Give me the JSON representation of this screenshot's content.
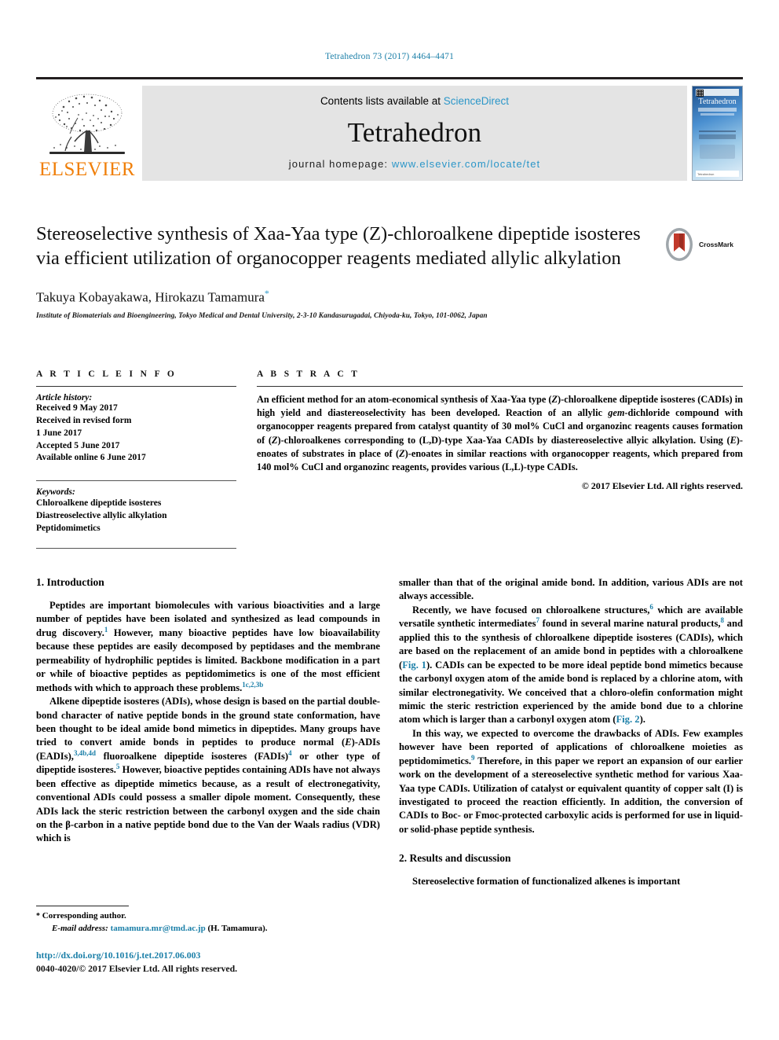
{
  "running_head": "Tetrahedron 73 (2017) 4464–4471",
  "masthead": {
    "publisher_word": "ELSEVIER",
    "contents_prefix": "Contents lists available at ",
    "contents_link": "ScienceDirect",
    "journal_title": "Tetrahedron",
    "homepage_prefix": "journal homepage: ",
    "homepage_url": "www.elsevier.com/locate/tet",
    "cover_title": "Tetrahedron",
    "cover_footer": "Tetrahedron"
  },
  "title_block": {
    "title": "Stereoselective synthesis of Xaa-Yaa type (Z)-chloroalkene dipeptide isosteres via efficient utilization of organocopper reagents mediated allylic alkylation",
    "authors": "Takuya Kobayakawa, Hirokazu Tamamura",
    "corresponding_marker": "*",
    "affiliation": "Institute of Biomaterials and Bioengineering, Tokyo Medical and Dental University, 2-3-10 Kandasurugadai, Chiyoda-ku, Tokyo, 101-0062, Japan",
    "crossmark_label": "CrossMark"
  },
  "article_info": {
    "heading": "A R T I C L E  I N F O",
    "history_label": "Article history:",
    "history_lines": [
      "Received 9 May 2017",
      "Received in revised form",
      "1 June 2017",
      "Accepted 5 June 2017",
      "Available online 6 June 2017"
    ],
    "keywords_label": "Keywords:",
    "keywords": [
      "Chloroalkene dipeptide isosteres",
      "Diastreoselective allylic alkylation",
      "Peptidomimetics"
    ]
  },
  "abstract": {
    "heading": "A B S T R A C T",
    "text_segments": [
      {
        "t": "An efficient method for an atom-economical synthesis of Xaa-Yaa type ("
      },
      {
        "t": "Z",
        "style": "italic"
      },
      {
        "t": ")-chloroalkene dipeptide isosteres (CADIs) in high yield and diastereoselectivity has been developed. Reaction of an allylic "
      },
      {
        "t": "gem",
        "style": "italic"
      },
      {
        "t": "-dichloride compound with organocopper reagents prepared from catalyst quantity of 30 mol% CuCl and organozinc reagents causes formation of ("
      },
      {
        "t": "Z",
        "style": "italic"
      },
      {
        "t": ")-chloroalkenes corresponding to (L,D)-type Xaa-Yaa CADIs by diastereoselective allyic alkylation. Using ("
      },
      {
        "t": "E",
        "style": "italic"
      },
      {
        "t": ")-enoates of substrates in place of ("
      },
      {
        "t": "Z",
        "style": "italic"
      },
      {
        "t": ")-enoates in similar reactions with organocopper reagents, which prepared from 140 mol% CuCl and organozinc reagents, provides various (L,L)-type CADIs."
      }
    ],
    "copyright": "© 2017 Elsevier Ltd. All rights reserved."
  },
  "sections": {
    "intro_heading": "1. Introduction",
    "results_heading": "2. Results and discussion"
  },
  "columns": {
    "left": [
      {
        "id": "p1",
        "segments": [
          {
            "t": "Peptides are important biomolecules with various bioactivities and a large number of peptides have been isolated and synthesized as lead compounds in drug discovery."
          },
          {
            "t": "1",
            "style": "ref"
          },
          {
            "t": " However, many bioactive peptides have low bioavailability because these peptides are easily decomposed by peptidases and the membrane permeability of hydrophilic peptides is limited. Backbone modification in a part or while of bioactive peptides as peptidomimetics is one of the most efficient methods with which to approach these problems."
          },
          {
            "t": "1c,2,3b",
            "style": "ref"
          }
        ]
      },
      {
        "id": "p2",
        "segments": [
          {
            "t": "Alkene dipeptide isosteres (ADIs), whose design is based on the partial double-bond character of native peptide bonds in the ground state conformation, have been thought to be ideal amide bond mimetics in dipeptides. Many groups have tried to convert amide bonds in peptides to produce normal ("
          },
          {
            "t": "E",
            "style": "italic"
          },
          {
            "t": ")-ADIs (EADIs),"
          },
          {
            "t": "3,4b,4d",
            "style": "ref"
          },
          {
            "t": " fluoroalkene dipeptide isosteres (FADIs)"
          },
          {
            "t": "4",
            "style": "ref"
          },
          {
            "t": " or other type of dipeptide isosteres."
          },
          {
            "t": "5",
            "style": "ref"
          },
          {
            "t": " However, bioactive peptides containing ADIs have not always been effective as dipeptide mimetics because, as a result of electronegativity, conventional ADIs could possess a smaller dipole moment. Consequently, these ADIs lack the steric restriction between the carbonyl oxygen and the side chain on the β-carbon in a native peptide bond due to the Van der Waals radius (VDR) which is"
          }
        ]
      }
    ],
    "right": [
      {
        "id": "p3",
        "indent": false,
        "segments": [
          {
            "t": "smaller than that of the original amide bond. In addition, various ADIs are not always accessible."
          }
        ]
      },
      {
        "id": "p4",
        "indent": true,
        "segments": [
          {
            "t": "Recently, we have focused on chloroalkene structures,"
          },
          {
            "t": "6",
            "style": "ref"
          },
          {
            "t": " which are available versatile synthetic intermediates"
          },
          {
            "t": "7",
            "style": "ref"
          },
          {
            "t": " found in several marine natural products,"
          },
          {
            "t": "8",
            "style": "ref"
          },
          {
            "t": " and applied this to the synthesis of chloroalkene dipeptide isosteres (CADIs), which are based on the replacement of an amide bond in peptides with a chloroalkene ("
          },
          {
            "t": "Fig. 1",
            "style": "link"
          },
          {
            "t": "). CADIs can be expected to be more ideal peptide bond mimetics because the carbonyl oxygen atom of the amide bond is replaced by a chlorine atom, with similar electronegativity. We conceived that a chloro-olefin conformation might mimic the steric restriction experienced by the amide bond due to a chlorine atom which is larger than a carbonyl oxygen atom ("
          },
          {
            "t": "Fig. 2",
            "style": "link"
          },
          {
            "t": ")."
          }
        ]
      },
      {
        "id": "p5",
        "indent": true,
        "segments": [
          {
            "t": "In this way, we expected to overcome the drawbacks of ADIs. Few examples however have been reported of applications of chloroalkene moieties as peptidomimetics."
          },
          {
            "t": "9",
            "style": "ref"
          },
          {
            "t": " Therefore, in this paper we report an expansion of our earlier work on the development of a stereoselective synthetic method for various Xaa-Yaa type CADIs. Utilization of catalyst or equivalent quantity of copper salt (I) is investigated to proceed the reaction efficiently. In addition, the conversion of CADIs to Boc- or Fmoc-protected carboxylic acids is performed for use in liquid- or solid-phase peptide synthesis."
          }
        ]
      },
      {
        "id": "p6",
        "indent": true,
        "segments": [
          {
            "t": "Stereoselective formation of functionalized alkenes is important"
          }
        ]
      }
    ]
  },
  "footnote": {
    "corresponding": "Corresponding author.",
    "email_label": "E-mail address:",
    "email": "tamamura.mr@tmd.ac.jp",
    "email_suffix": "(H. Tamamura).",
    "star": "*"
  },
  "footer": {
    "doi": "http://dx.doi.org/10.1016/j.tet.2017.06.003",
    "issn": "0040-4020/© 2017 Elsevier Ltd. All rights reserved."
  },
  "colors": {
    "link": "#1b7fa8",
    "sciencedirect": "#2b96c8",
    "elsevier_orange": "#f07f09",
    "band_gray": "#e4e4e4"
  }
}
